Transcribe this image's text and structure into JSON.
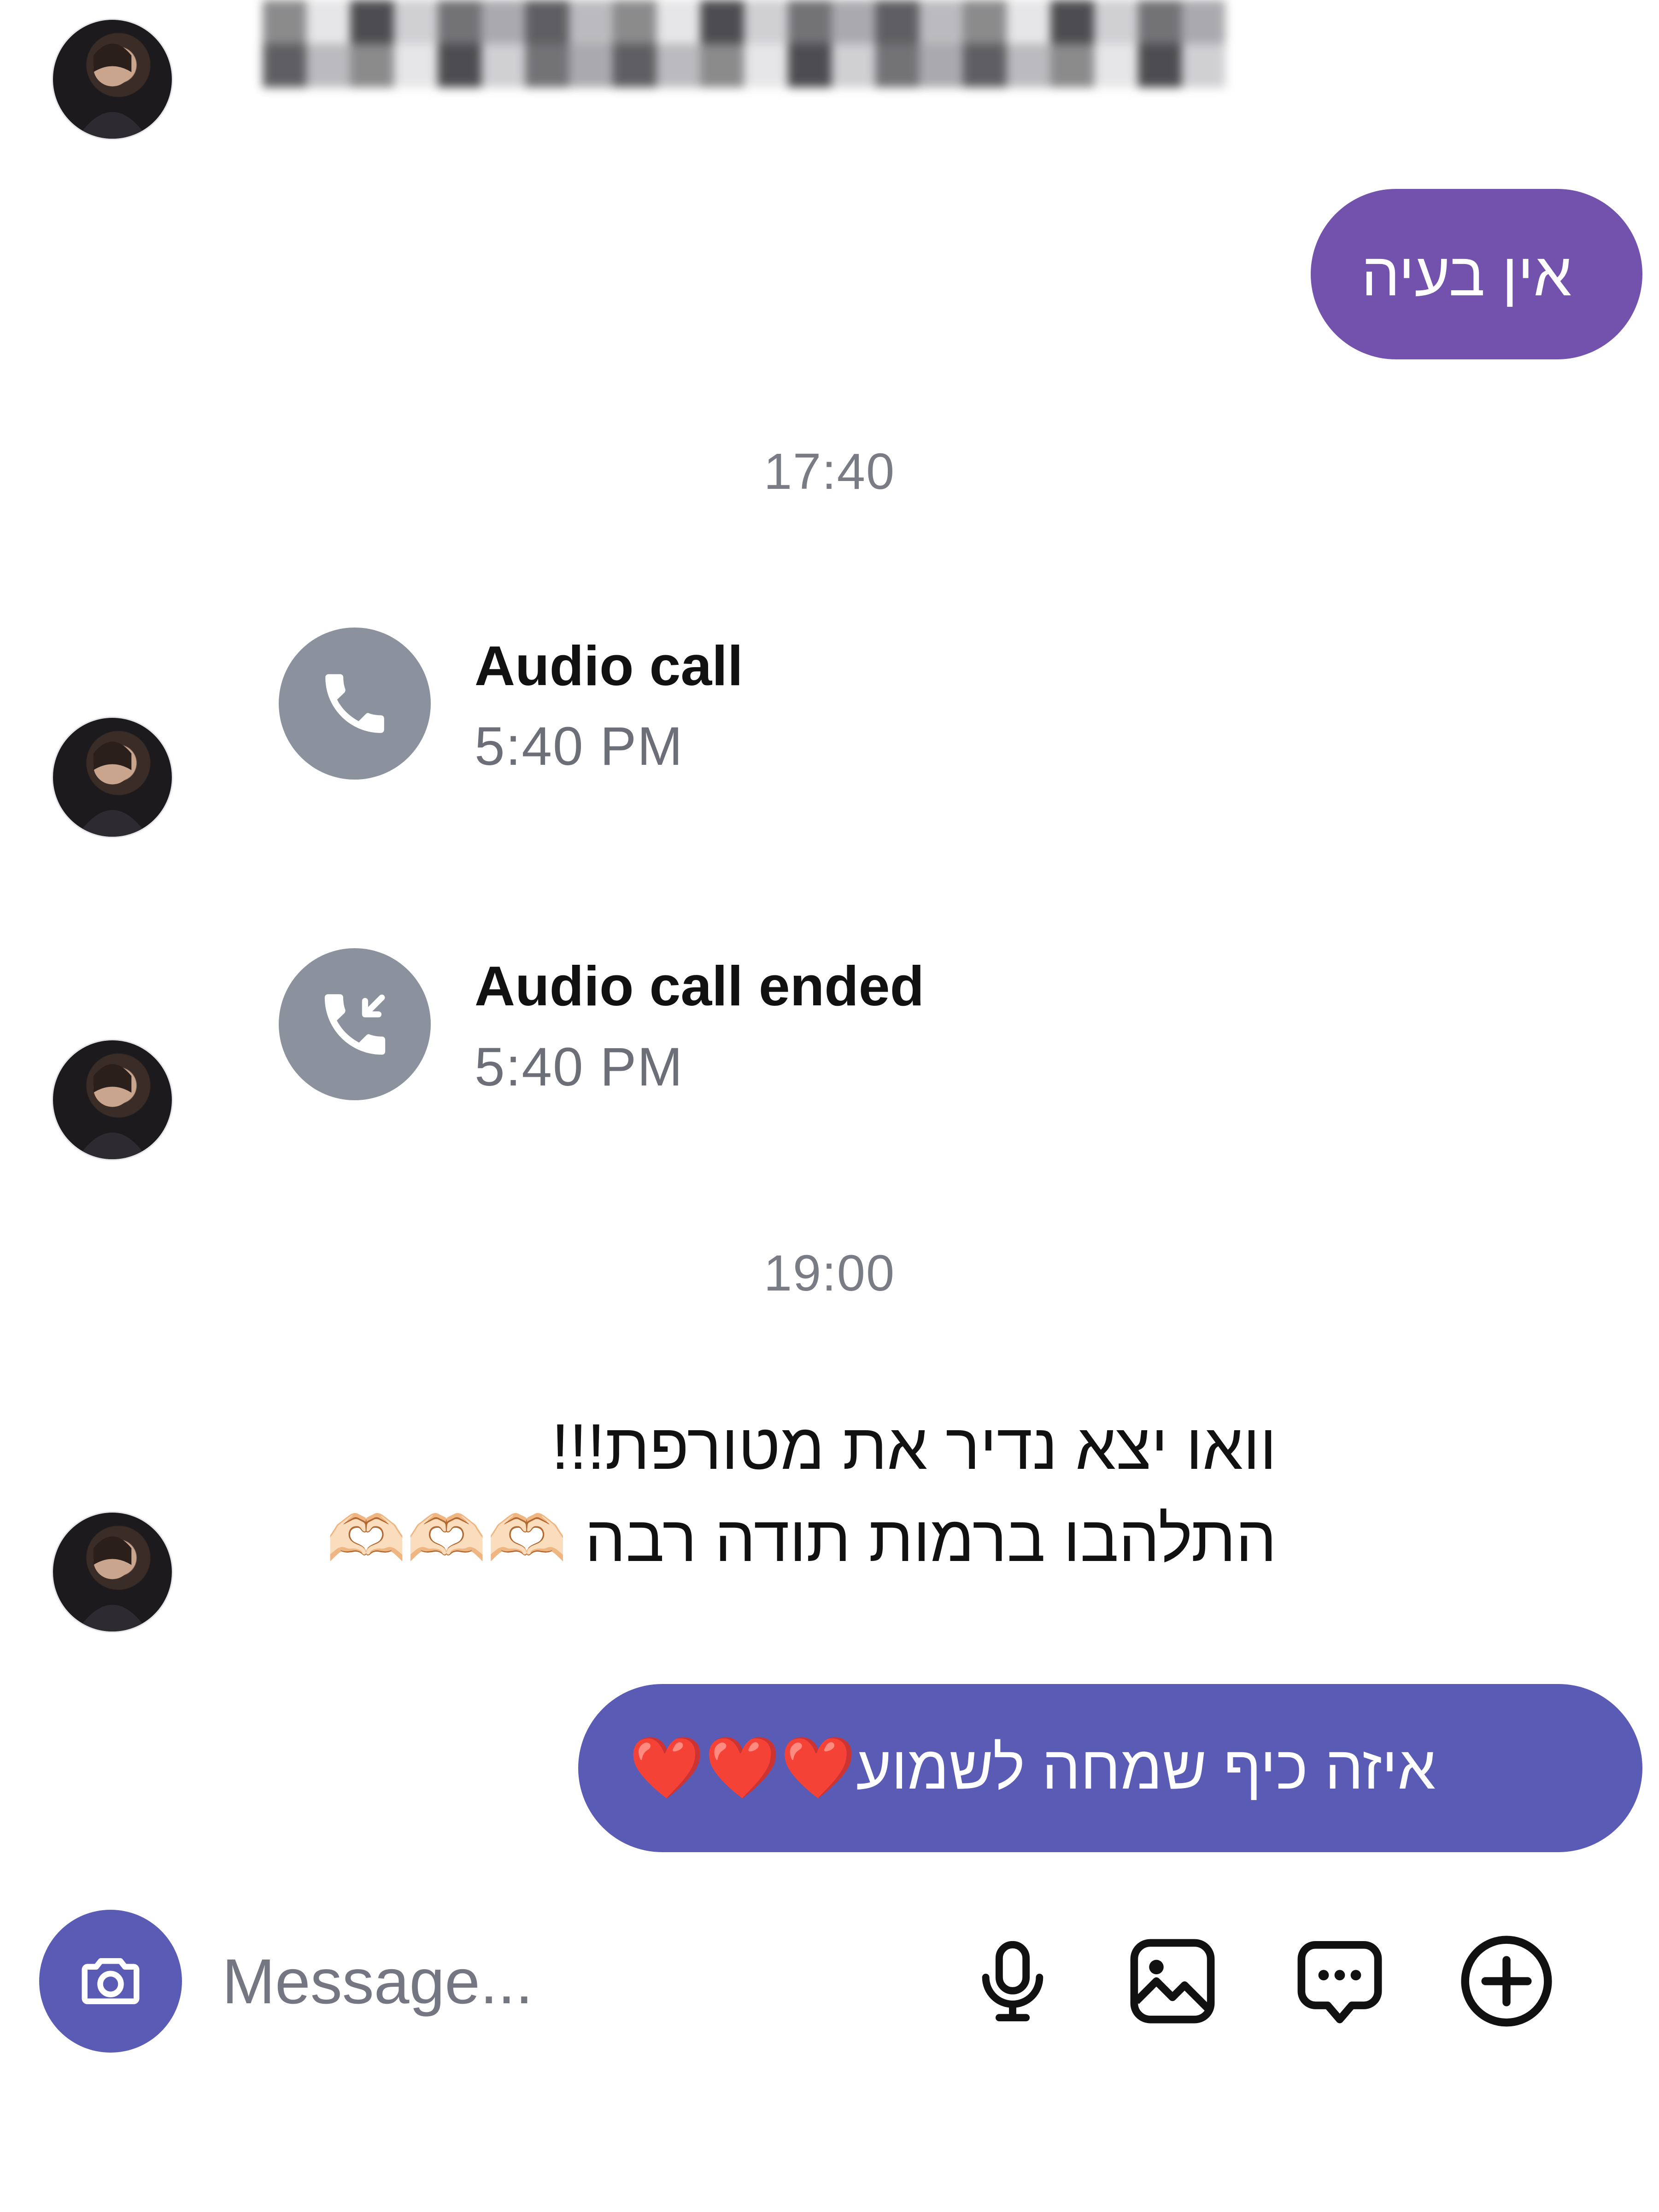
{
  "thread": {
    "messages": [
      {
        "direction": "outgoing",
        "text": "אין בעיה"
      },
      {
        "type": "timestamp",
        "text": "17:40"
      },
      {
        "type": "call",
        "title": "Audio call",
        "time": "5:40 PM",
        "icon": "phone-icon"
      },
      {
        "type": "call",
        "title": "Audio call ended",
        "time": "5:40 PM",
        "icon": "phone-incoming-icon"
      },
      {
        "type": "timestamp",
        "text": "19:00"
      },
      {
        "direction": "incoming",
        "line1": "וואו יצא נדיר את מטורפת!!!",
        "line2": "התלהבו ברמות תודה רבה 🫶🏻🫶🏻🫶🏻"
      },
      {
        "direction": "outgoing",
        "text": "איזה כיף שמחה לשמוע❤️❤️❤️"
      }
    ]
  },
  "composer": {
    "placeholder": "Message...",
    "icons": [
      "camera-icon",
      "microphone-icon",
      "gallery-icon",
      "sticker-icon",
      "add-icon"
    ]
  },
  "colors": {
    "outgoing_bubble_1": "#7352ad",
    "outgoing_bubble_2": "#5a5bb5",
    "call_icon_bg": "#8c929d",
    "timestamp_text": "#7a7c85",
    "camera_button": "#5a5bb5"
  }
}
